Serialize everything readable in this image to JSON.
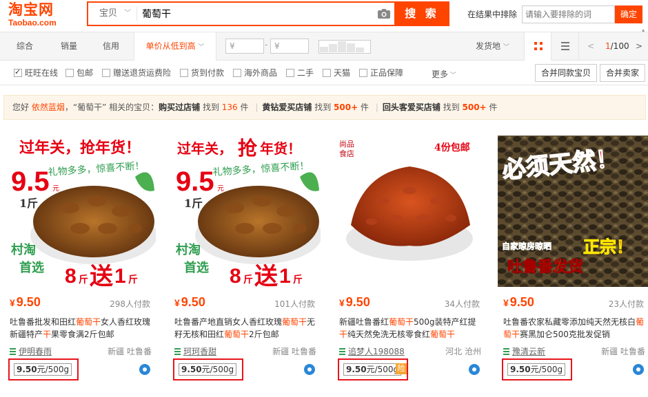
{
  "logo": {
    "cn": "淘宝网",
    "en": "Taobao.com"
  },
  "search": {
    "scope": "宝贝",
    "query": "葡萄干",
    "button": "搜 索"
  },
  "exclude": {
    "label": "在结果中排除",
    "placeholder": "请输入要排除的词",
    "button": "确定"
  },
  "sort_tabs": [
    "综合",
    "销量",
    "信用",
    "单价从低到高"
  ],
  "active_sort": "单价从低到高",
  "price_range": {
    "min_placeholder": "¥",
    "max_placeholder": "¥",
    "dash": "-"
  },
  "ship_from": "发货地",
  "pager": {
    "prev": "<",
    "current": "1",
    "total": "/100",
    "next": ">"
  },
  "filters": [
    {
      "label": "旺旺在线",
      "checked": true
    },
    {
      "label": "包邮",
      "checked": false
    },
    {
      "label": "赠送退货运费险",
      "checked": false
    },
    {
      "label": "货到付款",
      "checked": false
    },
    {
      "label": "海外商品",
      "checked": false
    },
    {
      "label": "二手",
      "checked": false
    },
    {
      "label": "天猫",
      "checked": false
    },
    {
      "label": "正品保障",
      "checked": false
    }
  ],
  "more": "更多",
  "merge_same": "合并同款宝贝",
  "merge_sellers": "合并卖家",
  "notice": {
    "greeting": "您好",
    "user": "依然蓝烟",
    "query_part": "，“葡萄干” 相关的宝贝：",
    "seg1_label": "购买过店铺",
    "seg1_pre": " 找到 ",
    "seg1_count": "136",
    "seg1_post": " 件",
    "seg2_label": "黄钻爱买店铺",
    "seg2_pre": " 找到 ",
    "seg2_count": "500+",
    "seg2_post": " 件",
    "seg3_label": "回头客爱买店铺",
    "seg3_pre": " 找到 ",
    "seg3_count": "500+",
    "seg3_post": " 件",
    "sep": "|"
  },
  "products": [
    {
      "price": "9.50",
      "currency": "¥",
      "sales": "298人付款",
      "title_parts": [
        "吐鲁番批发和田红",
        "葡萄干",
        "女人香红玫瑰新疆特产",
        "干",
        "果零食满2斤包邮"
      ],
      "shop": "伊明春雨",
      "location": "新疆 吐鲁番",
      "unit_price": "9.50",
      "unit_suffix": "元/500g",
      "img_text": {
        "banner": "过年关，抢年货！",
        "promo": "9.5",
        "promo_unit": "元",
        "jin": "1斤",
        "slogan": "礼物多多，惊喜不断！",
        "corner1": "村淘",
        "corner2": "首选",
        "deal": "8",
        "deal_unit1": "斤",
        "deal_send": "送",
        "deal_num": "1",
        "deal_unit2": "斤"
      }
    },
    {
      "price": "9.50",
      "currency": "¥",
      "sales": "101人付款",
      "title_parts": [
        "吐鲁番产地直销女人香红玫瑰",
        "葡萄干",
        "无籽无核和田红",
        "葡萄干",
        "2斤包邮"
      ],
      "shop": "珂珂香甜",
      "location": "新疆 吐鲁番",
      "unit_price": "9.50",
      "unit_suffix": "元/500g",
      "img_text": {
        "banner1": "过年关，",
        "banner2": "抢",
        "banner3": "年货！",
        "promo": "9.5",
        "promo_unit": "元",
        "jin": "1斤",
        "slogan": "礼物多多，惊喜不断！",
        "corner1": "村淘",
        "corner2": "首选",
        "deal": "8",
        "deal_unit1": "斤",
        "deal_send": "送",
        "deal_num": "1",
        "deal_unit2": "斤"
      }
    },
    {
      "price": "9.50",
      "currency": "¥",
      "sales": "34人付款",
      "title_parts": [
        "新疆吐鲁番红",
        "葡萄干",
        "500g装特产红提",
        "干",
        "纯天然免洗无核零食红",
        "葡萄干",
        ""
      ],
      "shop": "追梦人198088",
      "location": "河北 沧州",
      "unit_price": "9.50",
      "unit_suffix": "元/500g",
      "badge": "险",
      "img_text": {
        "brand1": "尚品",
        "brand2": "食店",
        "mail": "4份包邮"
      }
    },
    {
      "price": "9.50",
      "currency": "¥",
      "sales": "23人付款",
      "title_parts": [
        "吐鲁番农家私藏零添加纯天然无核白",
        "葡萄干",
        "赛黑加仑500克批发促销"
      ],
      "shop": "豫清云新",
      "location": "新疆 吐鲁番",
      "unit_price": "9.50",
      "unit_suffix": "元/500g",
      "img_text": {
        "banner": "必须天然！",
        "dry": "自家晾房晾晒",
        "real": "正宗！",
        "origin": "吐鲁番发货"
      }
    }
  ],
  "colors": {
    "brand": "#ff4400",
    "highlight_box": "#e8141b",
    "notice_bg": "#fdf5ea"
  }
}
